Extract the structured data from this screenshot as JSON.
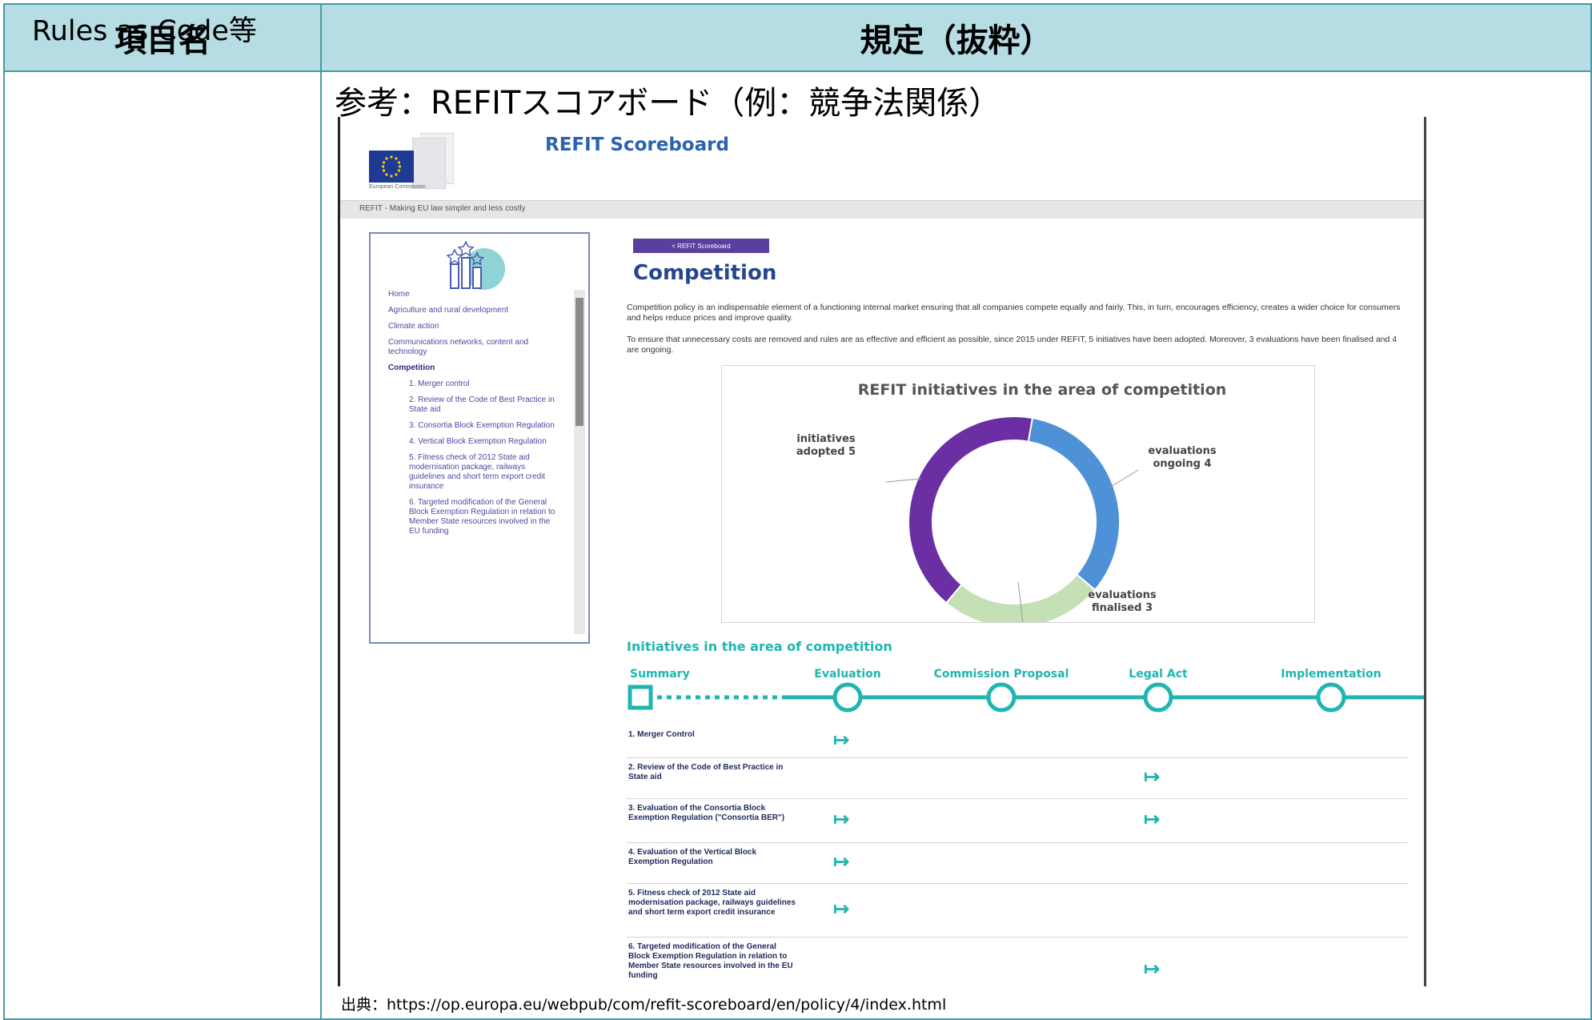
{
  "header": {
    "col1": "項目名",
    "col2": "規定（抜粋）"
  },
  "item_name": "Rules as Code等",
  "subtitle": "参考：REFITスコアボード（例：競争法関係）",
  "source": "出典：https://op.europa.eu/webpub/com/refit-scoreboard/en/policy/4/index.html",
  "screenshot": {
    "logo_caption": "European Commission",
    "site_title": "REFIT Scoreboard",
    "breadcrumb": "REFIT - Making EU law simpler and less costly",
    "back_button": "< REFIT Scoreboard",
    "page_title": "Competition",
    "para1": "Competition policy is an indispensable element of a functioning internal market ensuring that all companies compete equally and fairly. This, in turn, encourages efficiency, creates a wider choice for consumers and helps reduce prices and improve quality.",
    "para2": "To ensure that unnecessary costs are removed and rules are as effective and efficient as possible, since 2015 under REFIT, 5 initiatives have been adopted. Moreover, 3 evaluations have been finalised and 4 are ongoing.",
    "sidebar": {
      "items": [
        {
          "label": "Home",
          "level": 0
        },
        {
          "label": "Agriculture and rural development",
          "level": 0
        },
        {
          "label": "Climate action",
          "level": 0
        },
        {
          "label": "Communications networks, content and technology",
          "level": 0
        },
        {
          "label": "Competition",
          "level": 0,
          "active": true
        },
        {
          "label": "1. Merger control",
          "level": 1
        },
        {
          "label": "2. Review of the Code of Best Practice in State aid",
          "level": 1
        },
        {
          "label": "3. Consortia Block Exemption Regulation",
          "level": 1
        },
        {
          "label": "4. Vertical Block Exemption Regulation",
          "level": 1
        },
        {
          "label": "5. Fitness check of 2012 State aid modernisation package, railways guidelines and short term export credit insurance",
          "level": 1
        },
        {
          "label": "6. Targeted modification of the General Block Exemption Regulation in relation to Member State resources involved in the EU funding",
          "level": 1
        }
      ]
    },
    "initiatives_title": "Initiatives in the area of competition",
    "timeline": [
      "Summary",
      "Evaluation",
      "Commission Proposal",
      "Legal Act",
      "Implementation"
    ],
    "rows": [
      {
        "label": "1. Merger Control",
        "stages": [
          "Evaluation"
        ]
      },
      {
        "label": "2. Review of the Code of Best Practice in State aid",
        "stages": [
          "Legal Act"
        ]
      },
      {
        "label": "3. Evaluation of the Consortia Block Exemption Regulation (\"Consortia BER\")",
        "stages": [
          "Evaluation",
          "Legal Act"
        ]
      },
      {
        "label": "4. Evaluation of the Vertical Block Exemption Regulation",
        "stages": [
          "Evaluation"
        ]
      },
      {
        "label": "5. Fitness check of 2012 State aid modernisation package, railways guidelines and short term export credit insurance",
        "stages": [
          "Evaluation"
        ]
      },
      {
        "label": "6. Targeted modification of the General Block Exemption Regulation in relation to Member State resources involved in the EU funding",
        "stages": [
          "Legal Act"
        ]
      }
    ],
    "arrow_glyph": "↦"
  },
  "chart_data": {
    "type": "pie",
    "title": "REFIT initiatives in the area of competition",
    "categories": [
      "evaluations ongoing",
      "evaluations finalised",
      "initiatives adopted"
    ],
    "values": [
      4,
      3,
      5
    ],
    "labels": [
      "evaluations ongoing 4",
      "evaluations finalised 3",
      "initiatives adopted 5"
    ],
    "colors": [
      "#4f91d6",
      "#c4e0b4",
      "#6b2fa3"
    ],
    "donut": true
  }
}
